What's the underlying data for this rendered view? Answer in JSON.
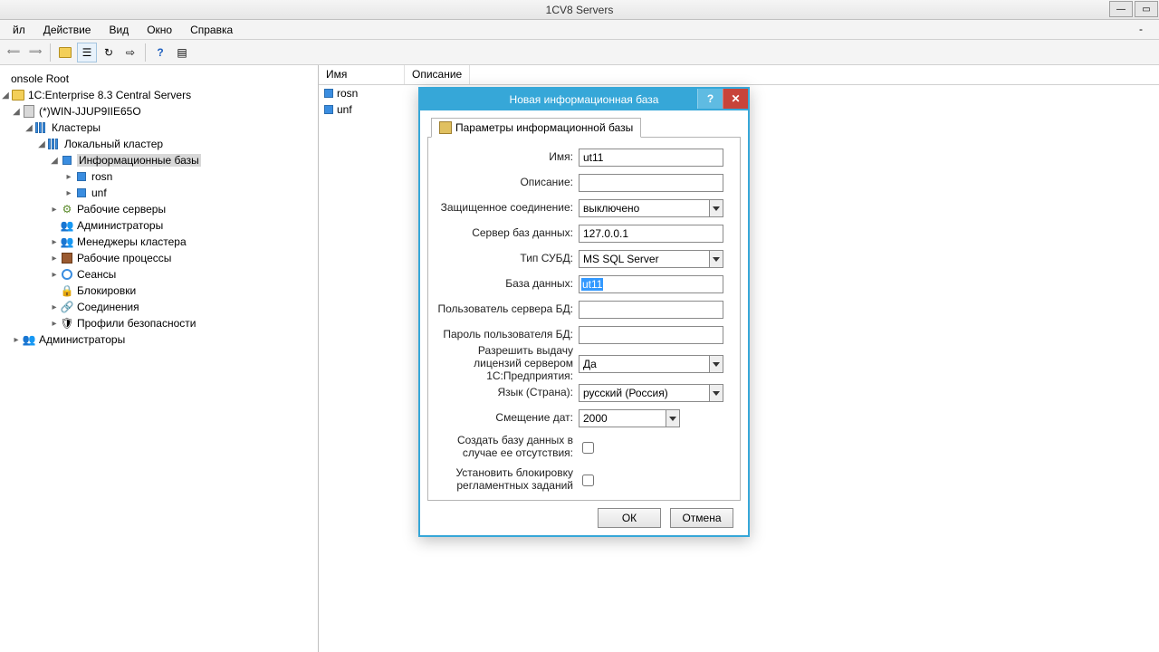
{
  "window": {
    "title": "1CV8 Servers"
  },
  "menu": {
    "file": "йл",
    "action": "Действие",
    "view": "Вид",
    "window": "Окно",
    "help": "Справка"
  },
  "tree": {
    "root": "onsole Root",
    "central": "1C:Enterprise 8.3 Central Servers",
    "host": "(*)WIN-JJUP9IIE65O",
    "clusters": "Кластеры",
    "local": "Локальный кластер",
    "infobases": "Информационные базы",
    "ib1": "rosn",
    "ib2": "unf",
    "workservers": "Рабочие серверы",
    "admins": "Администраторы",
    "managers": "Менеджеры кластера",
    "processes": "Рабочие процессы",
    "sessions": "Сеансы",
    "locks": "Блокировки",
    "connections": "Соединения",
    "security": "Профили безопасности",
    "rootadmins": "Администраторы"
  },
  "cols": {
    "name": "Имя",
    "desc": "Описание"
  },
  "rows": {
    "r1": "rosn",
    "r2": "unf"
  },
  "dialog": {
    "title": "Новая информационная база",
    "tab": "Параметры информационной базы",
    "labels": {
      "name": "Имя:",
      "desc": "Описание:",
      "secure": "Защищенное соединение:",
      "dbserver": "Сервер баз данных:",
      "dbtype": "Тип СУБД:",
      "dbname": "База данных:",
      "dbuser": "Пользователь сервера БД:",
      "dbpass": "Пароль пользователя БД:",
      "license": "Разрешить выдачу лицензий сервером 1С:Предприятия:",
      "lang": "Язык (Страна):",
      "offset": "Смещение дат:",
      "create": "Создать базу данных в случае ее отсутствия:",
      "block": "Установить блокировку регламентных заданий"
    },
    "values": {
      "name": "ut11",
      "desc": "",
      "secure": "выключено",
      "dbserver": "127.0.0.1",
      "dbtype": "MS SQL Server",
      "dbname": "ut11",
      "dbuser": "",
      "dbpass": "",
      "license": "Да",
      "lang": "русский (Россия)",
      "offset": "2000"
    },
    "buttons": {
      "ok": "ОК",
      "cancel": "Отмена"
    }
  }
}
